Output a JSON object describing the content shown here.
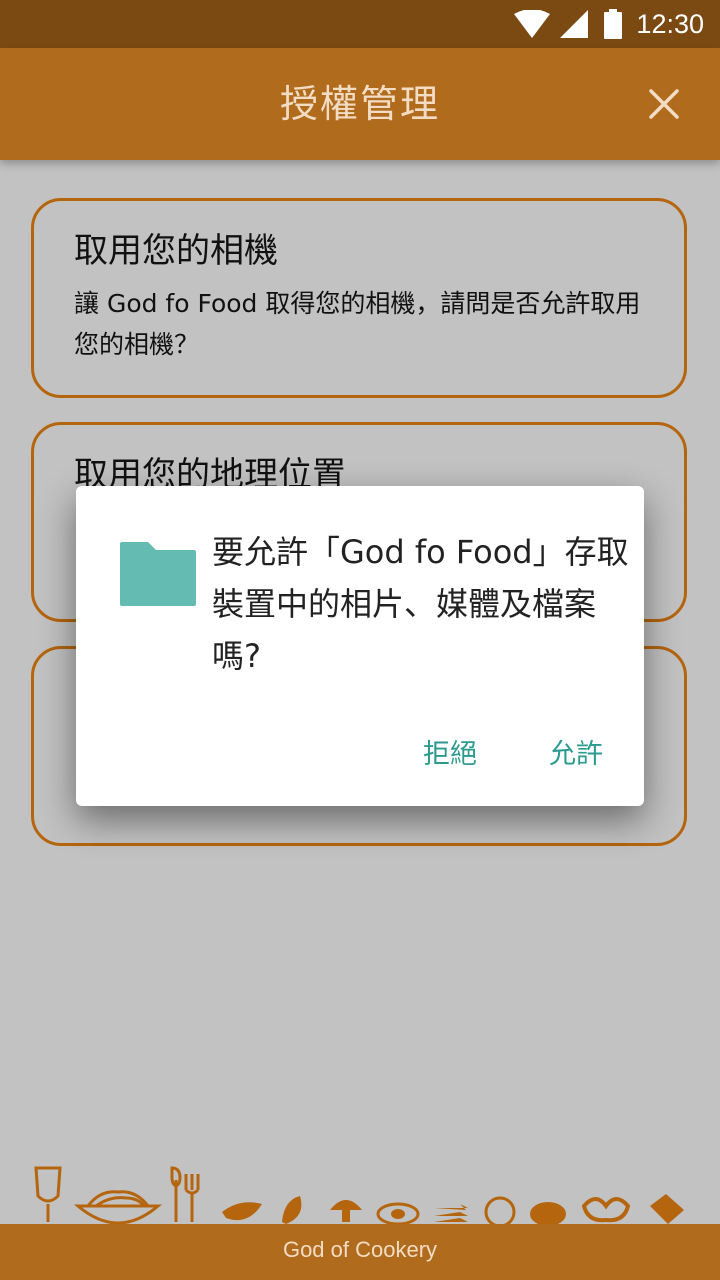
{
  "status": {
    "time": "12:30"
  },
  "header": {
    "title": "授權管理"
  },
  "cards": [
    {
      "title": "取用您的相機",
      "desc": "讓 God fo Food 取得您的相機，請問是否允許取用您的相機？"
    },
    {
      "title": "取用您的地理位置",
      "desc": ""
    },
    {
      "title": "",
      "desc": ""
    }
  ],
  "dialog": {
    "message": "要允許「God fo Food」存取裝置中的相片、媒體及檔案嗎?",
    "deny_label": "拒絕",
    "allow_label": "允許",
    "icon": "folder-icon",
    "icon_color": "#63bbb1"
  },
  "footer": {
    "text": "God of Cookery"
  },
  "colors": {
    "accent": "#b16b1c",
    "status_bar": "#7b4a12",
    "dialog_button": "#2b9a8f"
  }
}
